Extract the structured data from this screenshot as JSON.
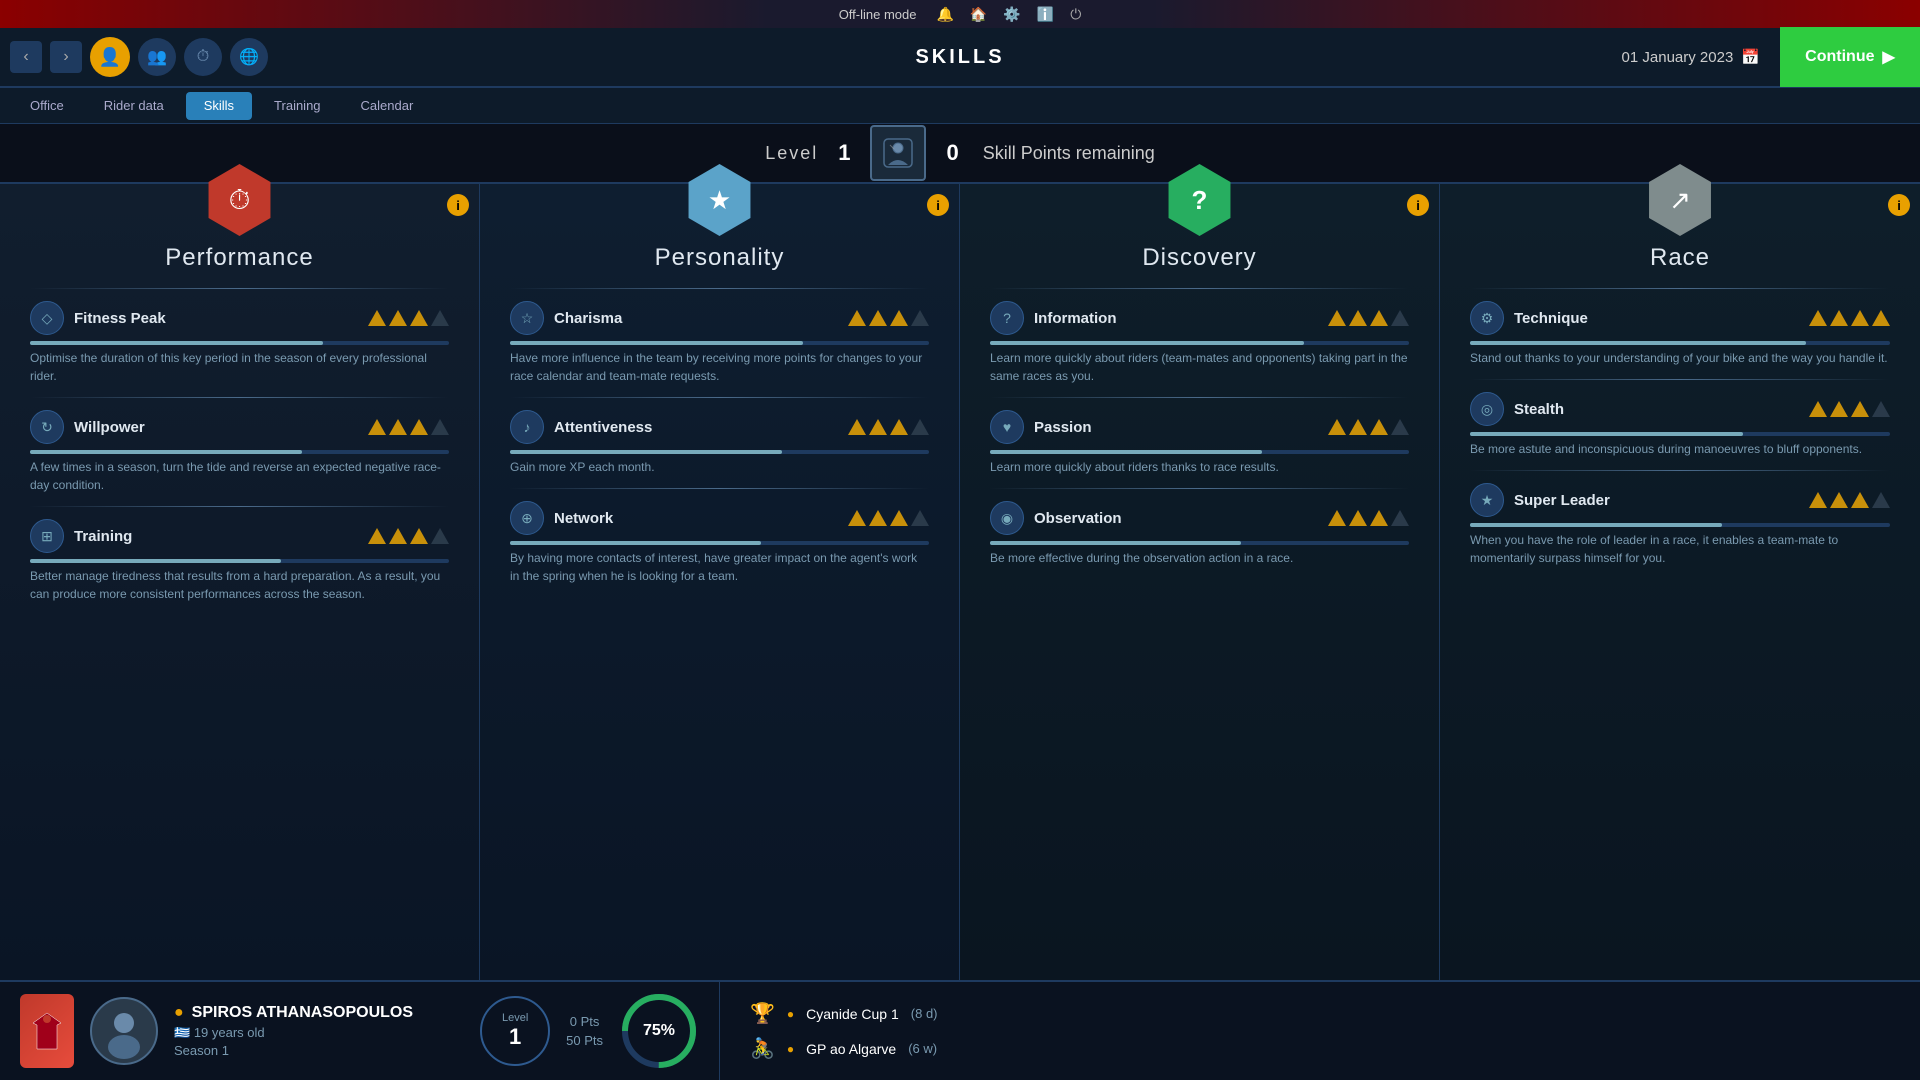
{
  "topbar": {
    "mode": "Off-line mode",
    "icons": [
      "🔔",
      "🏠",
      "⚙️",
      "ℹ️",
      "⏻"
    ]
  },
  "navbar": {
    "title": "SKILLS",
    "date": "01 January 2023",
    "continue_label": "Continue"
  },
  "tabs": [
    {
      "id": "office",
      "label": "Office",
      "active": false
    },
    {
      "id": "rider-data",
      "label": "Rider data",
      "active": false
    },
    {
      "id": "skills",
      "label": "Skills",
      "active": true
    },
    {
      "id": "training",
      "label": "Training",
      "active": false
    },
    {
      "id": "calendar",
      "label": "Calendar",
      "active": false
    }
  ],
  "level_bar": {
    "level_label": "Level",
    "level_value": "1",
    "skill_points": "0",
    "skill_points_label": "Skill Points remaining"
  },
  "columns": [
    {
      "id": "performance",
      "title": "Performance",
      "hex_color": "red",
      "icon": "⏱",
      "skills": [
        {
          "id": "fitness-peak",
          "name": "Fitness Peak",
          "icon": "◇",
          "stars_filled": 3,
          "stars_total": 4,
          "bar_pct": 70,
          "description": "Optimise the duration of this key period in the season of every professional rider."
        },
        {
          "id": "willpower",
          "name": "Willpower",
          "icon": "↻",
          "stars_filled": 3,
          "stars_total": 4,
          "bar_pct": 65,
          "description": "A few times in a season, turn the tide and reverse an expected negative race-day condition."
        },
        {
          "id": "training",
          "name": "Training",
          "icon": "⊞",
          "stars_filled": 3,
          "stars_total": 4,
          "bar_pct": 60,
          "description": "Better manage tiredness that results from a hard preparation. As a result, you can produce more consistent performances across the season."
        }
      ]
    },
    {
      "id": "personality",
      "title": "Personality",
      "hex_color": "blue",
      "icon": "★",
      "skills": [
        {
          "id": "charisma",
          "name": "Charisma",
          "icon": "☆",
          "stars_filled": 3,
          "stars_total": 4,
          "bar_pct": 70,
          "description": "Have more influence in the team by receiving more points for changes to your race calendar and team-mate requests."
        },
        {
          "id": "attentiveness",
          "name": "Attentiveness",
          "icon": "♪",
          "stars_filled": 3,
          "stars_total": 4,
          "bar_pct": 65,
          "description": "Gain more XP each month."
        },
        {
          "id": "network",
          "name": "Network",
          "icon": "⊕",
          "stars_filled": 3,
          "stars_total": 4,
          "bar_pct": 60,
          "description": "By having more contacts of interest, have greater impact on the agent's work in the spring when he is looking for a team."
        }
      ]
    },
    {
      "id": "discovery",
      "title": "Discovery",
      "hex_color": "green",
      "icon": "?",
      "skills": [
        {
          "id": "information",
          "name": "Information",
          "icon": "?",
          "stars_filled": 3,
          "stars_total": 4,
          "bar_pct": 75,
          "description": "Learn more quickly about riders (team-mates and opponents) taking part in the same races as you."
        },
        {
          "id": "passion",
          "name": "Passion",
          "icon": "♥",
          "stars_filled": 3,
          "stars_total": 4,
          "bar_pct": 65,
          "description": "Learn more quickly about riders thanks to race results."
        },
        {
          "id": "observation",
          "name": "Observation",
          "icon": "◉",
          "stars_filled": 3,
          "stars_total": 4,
          "bar_pct": 60,
          "description": "Be more effective during the observation action in a race."
        }
      ]
    },
    {
      "id": "race",
      "title": "Race",
      "hex_color": "gray",
      "icon": "↗",
      "skills": [
        {
          "id": "technique",
          "name": "Technique",
          "icon": "⚙",
          "stars_filled": 4,
          "stars_total": 4,
          "bar_pct": 80,
          "description": "Stand out thanks to your understanding of your bike and the way you handle it."
        },
        {
          "id": "stealth",
          "name": "Stealth",
          "icon": "◎",
          "stars_filled": 3,
          "stars_total": 4,
          "bar_pct": 65,
          "description": "Be more astute and inconspicuous during manoeuvres to bluff opponents."
        },
        {
          "id": "super-leader",
          "name": "Super Leader",
          "icon": "★",
          "stars_filled": 3,
          "stars_total": 4,
          "bar_pct": 60,
          "description": "When you have the role of leader in a race, it enables a team-mate to momentarily surpass himself for you."
        }
      ]
    }
  ],
  "player": {
    "name": "SPIROS ATHANASOPOULOS",
    "age": "19 years old",
    "season": "Season 1",
    "level": "1",
    "pts_current": "0 Pts",
    "pts_max": "50 Pts",
    "progress_pct": 75,
    "flag": "🇬🇷"
  },
  "races": [
    {
      "icon": "🏆",
      "color_dot": "yellow",
      "name": "Cyanide Cup 1",
      "time": "(8 d)"
    },
    {
      "icon": "🚴",
      "color_dot": "yellow",
      "name": "GP ao Algarve",
      "time": "(6 w)"
    }
  ]
}
